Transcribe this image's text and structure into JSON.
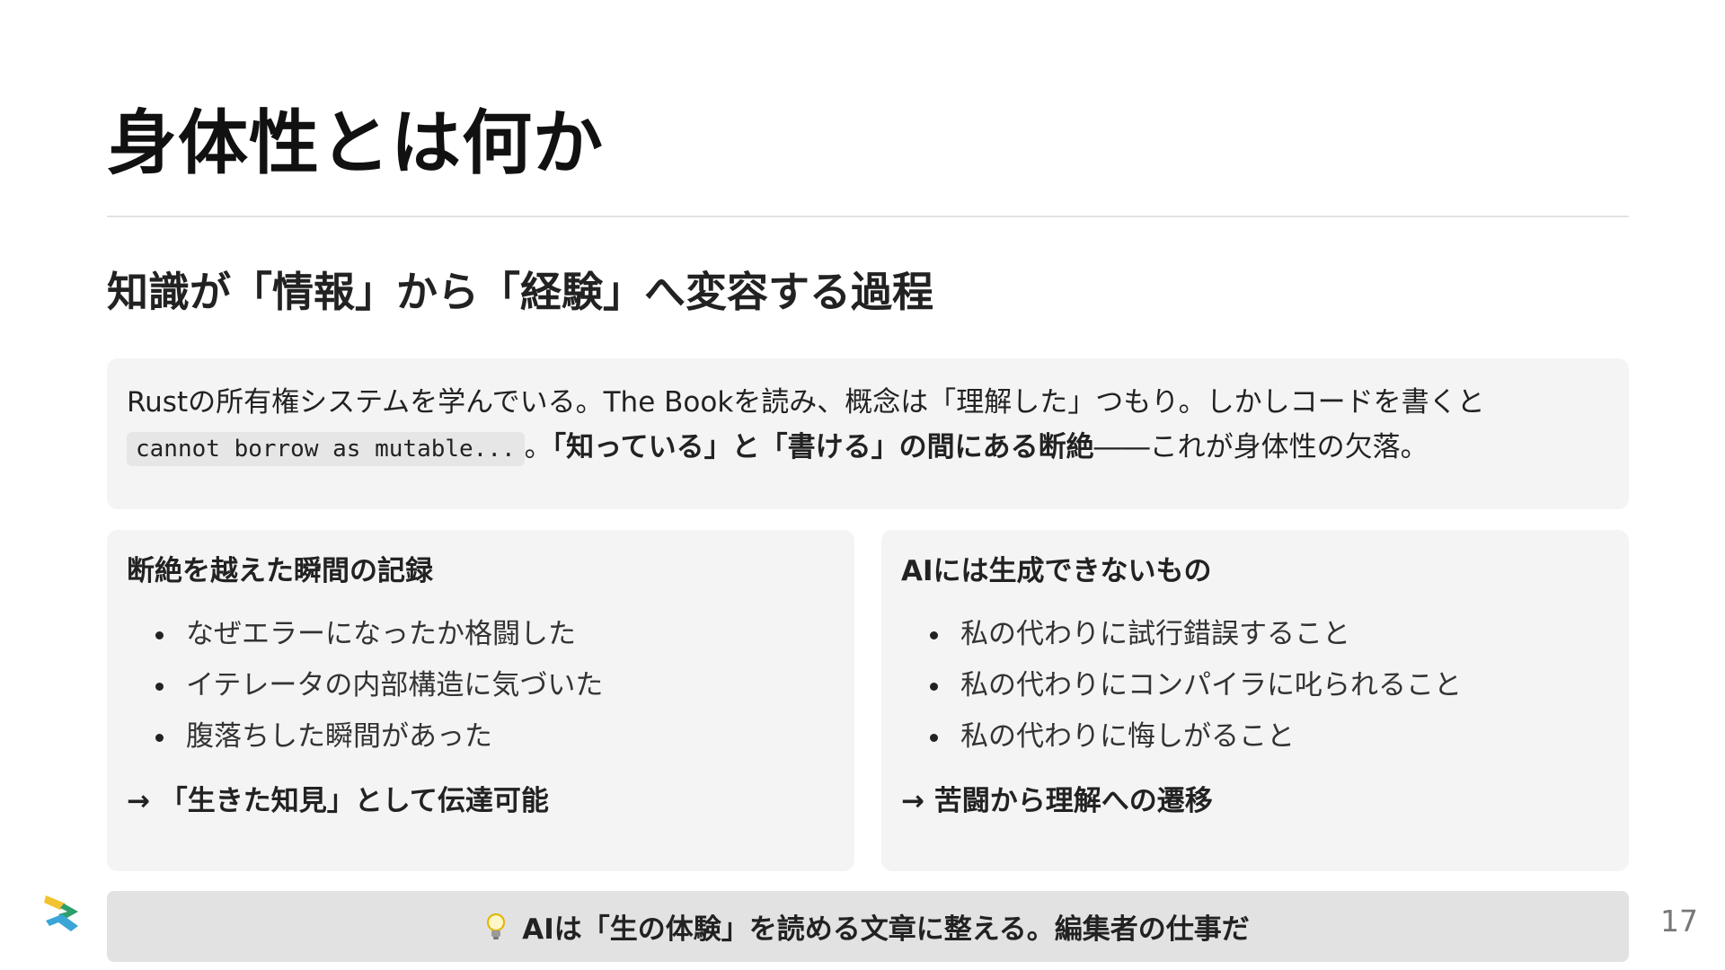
{
  "slide": {
    "title": "身体性とは何か",
    "subtitle": "知識が「情報」から「経験」へ変容する過程",
    "intro": {
      "line1": "Rustの所有権システムを学んでいる。The Bookを読み、概念は「理解した」つもり。しかしコードを書くと",
      "code": "cannot borrow as mutable...",
      "after_code": "。",
      "emphasis": "「知っている」と「書ける」の間にある断絶",
      "tail": "――これが身体性の欠落。"
    },
    "left_card": {
      "title": "断絶を越えた瞬間の記録",
      "items": [
        "なぜエラーになったか格闘した",
        "イテレータの内部構造に気づいた",
        "腹落ちした瞬間があった"
      ],
      "conclusion": "→ 「生きた知見」として伝達可能"
    },
    "right_card": {
      "title": "AIには生成できないもの",
      "items": [
        "私の代わりに試行錯誤すること",
        "私の代わりにコンパイラに叱られること",
        "私の代わりに悔しがること"
      ],
      "conclusion": "→ 苦闘から理解への遷移"
    },
    "footer": {
      "icon": "lightbulb-icon",
      "text": "AIは「生の体験」を読める文章に整える。編集者の仕事だ"
    },
    "page_number": "17",
    "logo": "brand-logo-icon"
  },
  "colors": {
    "background": "#ffffff",
    "card": "#f4f4f4",
    "footer": "#e2e2e2",
    "logo_yellow": "#f2c230",
    "logo_green": "#2e9e6b",
    "logo_blue": "#3aa6d8"
  }
}
